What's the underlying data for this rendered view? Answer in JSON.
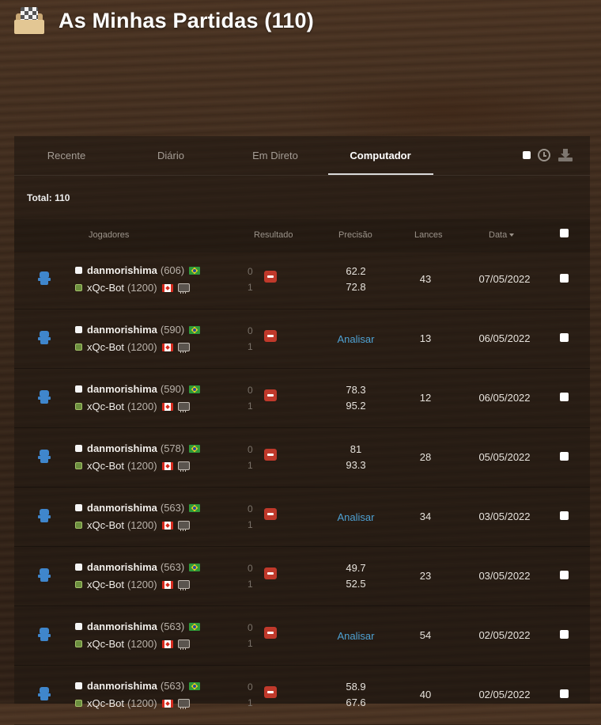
{
  "header": {
    "title": "As Minhas Partidas (110)",
    "icon": "folder-chessboard-icon"
  },
  "tabs": [
    {
      "label": "Recente",
      "active": false
    },
    {
      "label": "Diário",
      "active": false
    },
    {
      "label": "Em Direto",
      "active": false
    },
    {
      "label": "Computador",
      "active": true
    }
  ],
  "toolbar": {
    "icons": [
      "select-all-checkbox",
      "clock-icon",
      "download-icon"
    ]
  },
  "total": "Total: 110",
  "table": {
    "headers": {
      "players": "Jogadores",
      "result": "Resultado",
      "accuracy": "Precisão",
      "moves": "Lances",
      "date": "Data"
    },
    "rows": [
      {
        "p1": "danmorishima",
        "p1_rating": "(606)",
        "p2": "xQc-Bot",
        "p2_rating": "(1200)",
        "s1": "0",
        "s2": "1",
        "acc1": "62.2",
        "acc2": "72.8",
        "moves": "43",
        "date": "07/05/2022"
      },
      {
        "p1": "danmorishima",
        "p1_rating": "(590)",
        "p2": "xQc-Bot",
        "p2_rating": "(1200)",
        "s1": "0",
        "s2": "1",
        "analyze": "Analisar",
        "moves": "13",
        "date": "06/05/2022"
      },
      {
        "p1": "danmorishima",
        "p1_rating": "(590)",
        "p2": "xQc-Bot",
        "p2_rating": "(1200)",
        "s1": "0",
        "s2": "1",
        "acc1": "78.3",
        "acc2": "95.2",
        "moves": "12",
        "date": "06/05/2022"
      },
      {
        "p1": "danmorishima",
        "p1_rating": "(578)",
        "p2": "xQc-Bot",
        "p2_rating": "(1200)",
        "s1": "0",
        "s2": "1",
        "acc1": "81",
        "acc2": "93.3",
        "moves": "28",
        "date": "05/05/2022"
      },
      {
        "p1": "danmorishima",
        "p1_rating": "(563)",
        "p2": "xQc-Bot",
        "p2_rating": "(1200)",
        "s1": "0",
        "s2": "1",
        "analyze": "Analisar",
        "moves": "34",
        "date": "03/05/2022"
      },
      {
        "p1": "danmorishima",
        "p1_rating": "(563)",
        "p2": "xQc-Bot",
        "p2_rating": "(1200)",
        "s1": "0",
        "s2": "1",
        "acc1": "49.7",
        "acc2": "52.5",
        "moves": "23",
        "date": "03/05/2022"
      },
      {
        "p1": "danmorishima",
        "p1_rating": "(563)",
        "p2": "xQc-Bot",
        "p2_rating": "(1200)",
        "s1": "0",
        "s2": "1",
        "analyze": "Analisar",
        "moves": "54",
        "date": "02/05/2022"
      },
      {
        "p1": "danmorishima",
        "p1_rating": "(563)",
        "p2": "xQc-Bot",
        "p2_rating": "(1200)",
        "s1": "0",
        "s2": "1",
        "acc1": "58.9",
        "acc2": "67.6",
        "moves": "40",
        "date": "02/05/2022"
      }
    ]
  }
}
